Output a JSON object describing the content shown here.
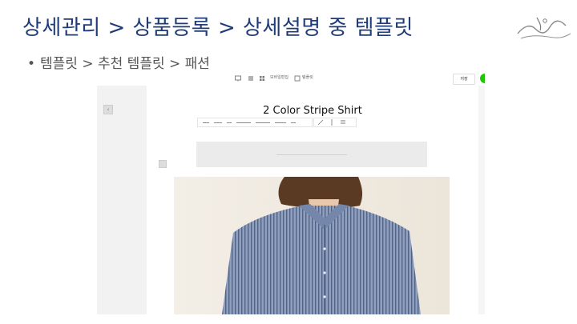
{
  "slide": {
    "title": "상세관리 > 상품등록 > 상세설명 중 템플릿",
    "bullet": "템플릿 > 추천 템플릿 > 패션"
  },
  "editor": {
    "toolbar": {
      "item1": "모바일편집",
      "item2": "템플릿",
      "save_label": "저장"
    },
    "document_title": "2 Color Stripe Shirt"
  },
  "colors": {
    "title_blue": "#1f3b78",
    "naver_green": "#1ec800",
    "shirt_blue": "#6f84a8"
  }
}
